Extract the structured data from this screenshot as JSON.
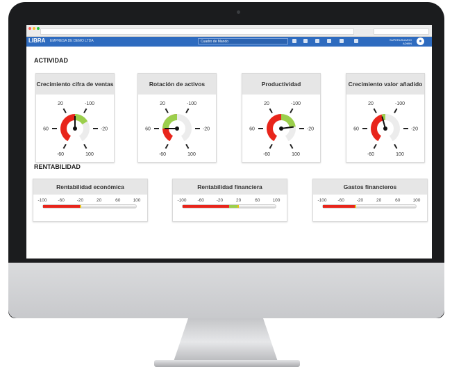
{
  "app": {
    "logo": "LIBRA",
    "company": "EMPRESA DE DEMO LTDA",
    "selector": "Cuadro de Mando",
    "user_name": "SUPERUSUARIO",
    "user_role": "ADMIN"
  },
  "colors": {
    "red": "#e8251b",
    "green": "#9bcf4c",
    "yellow": "#e8c21b",
    "accent": "#2e6bbf"
  },
  "sections": {
    "actividad": "ACTIVIDAD",
    "rentabilidad": "RENTABILIDAD"
  },
  "gauges": [
    {
      "title": "Crecimiento cifra de ventas",
      "labels": [
        "-20",
        "20",
        "-60",
        "60",
        "-100",
        "100"
      ],
      "value": 0,
      "fill_from": 0,
      "fill_to": 40
    },
    {
      "title": "Rotación de activos",
      "labels": [
        "-20",
        "20",
        "-60",
        "60",
        "-100",
        "100"
      ],
      "value": -60,
      "fill_from": -60,
      "fill_to": 0
    },
    {
      "title": "Productividad",
      "labels": [
        "-20",
        "20",
        "-60",
        "60",
        "-100",
        "100"
      ],
      "value": 55,
      "fill_from": 0,
      "fill_to": 55
    },
    {
      "title": "Crecimiento valor añadido",
      "labels": [
        "-20",
        "20",
        "-60",
        "60",
        "-100",
        "100"
      ],
      "value": -10,
      "fill_from": -10,
      "fill_to": 0
    }
  ],
  "bars": [
    {
      "title": "Rentabilidad económica",
      "labels": [
        "-100",
        "-60",
        "-20",
        "20",
        "60",
        "100"
      ],
      "value": -20
    },
    {
      "title": "Rentabilidad financiera",
      "labels": [
        "-100",
        "-60",
        "-20",
        "20",
        "60",
        "100"
      ],
      "value": 20
    },
    {
      "title": "Gastos financieros",
      "labels": [
        "-100",
        "-60",
        "-20",
        "20",
        "60",
        "100"
      ],
      "value": -30
    }
  ]
}
